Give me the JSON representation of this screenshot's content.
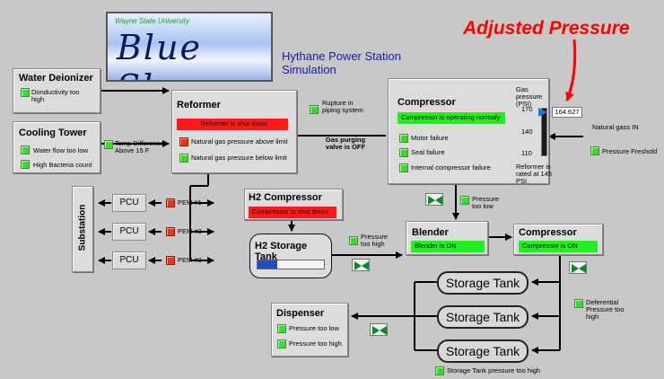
{
  "logo": {
    "university": "Wayne State University",
    "wordmark": "Blue Sky"
  },
  "title": {
    "line1": "Hythane Power Station",
    "line2": "Simulation"
  },
  "annotation": "Adjusted Pressure",
  "water_deionizer": {
    "title": "Water Deionizer",
    "alarm": "Donductivity too high"
  },
  "cooling_tower": {
    "title": "Cooling Tower",
    "alarms": [
      "Water flow too low",
      "High Bacteria count"
    ],
    "temp_diff": "Temp Difference Above 15 F"
  },
  "reformer": {
    "title": "Reformer",
    "status": "Reformer is shut down",
    "alarms": [
      "Natural gas pressure above limit",
      "Natural gas pressure below limit"
    ]
  },
  "rupture": "Rupture in piping system",
  "purging": "Gas purging valve is OFF",
  "compressor1": {
    "title": "Compressor",
    "status": "Compressor is operating normaly",
    "alarms": [
      "Motor failure",
      "Seal failure",
      "Internal compressor failure"
    ],
    "gauge_title": "Gas pressure (PSI)",
    "ticks": [
      "170",
      "140",
      "110"
    ],
    "value": "164.627",
    "value_number": 164.627,
    "range": [
      110,
      170
    ],
    "rated": "Reformer is rated at 145 PSI"
  },
  "natural_gas_in": "Natural gass IN",
  "pressure_freshold": "Pressure Freshold",
  "substation": "Substation",
  "pcu": [
    "PCU",
    "PCU",
    "PCU"
  ],
  "pem": [
    "PEM #1",
    "PEM #2",
    "PEM #3"
  ],
  "h2_compressor": {
    "title": "H2 Compressor",
    "status": "Compressor is shut down"
  },
  "pressure_too_high": "Pressure too high",
  "pressure_too_low": "Pressure too low",
  "h2_storage": {
    "title": "H2 Storage Tank",
    "level_fraction": 0.3
  },
  "blender": {
    "title": "Blender",
    "status": "Blender is ON"
  },
  "compressor2": {
    "title": "Compressor",
    "status": "Compressor is ON"
  },
  "storage_tanks": [
    "Storage Tank",
    "Storage Tank",
    "Storage Tank"
  ],
  "deferential": "Deferential Pressure too high",
  "dispenser": {
    "title": "Dispenser",
    "alarms": [
      "Pressure too low",
      "Pressure too high"
    ]
  },
  "storage_alarm": "Storage Tank pressure too high",
  "colors": {
    "background": "#c8c8c8",
    "led_green": "#33dd33",
    "led_red": "#ee3311",
    "status_red": "#ff1a1a",
    "status_green": "#22ee22",
    "annotation": "#ff0000",
    "title_blue": "#1a1aa0"
  }
}
